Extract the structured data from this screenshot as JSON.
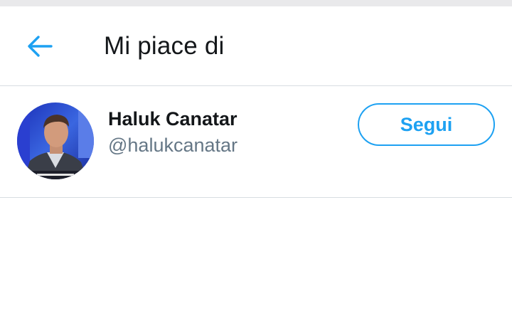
{
  "header": {
    "title": "Mi piace di",
    "back_icon": "arrow-left-icon"
  },
  "user": {
    "name": "Haluk Canatar",
    "handle": "@halukcanatar",
    "avatar_icon": "profile-photo",
    "follow_label": "Segui"
  },
  "colors": {
    "accent": "#1da1f2",
    "text_primary": "#14171a",
    "text_secondary": "#657786",
    "divider": "#d8dde2"
  }
}
